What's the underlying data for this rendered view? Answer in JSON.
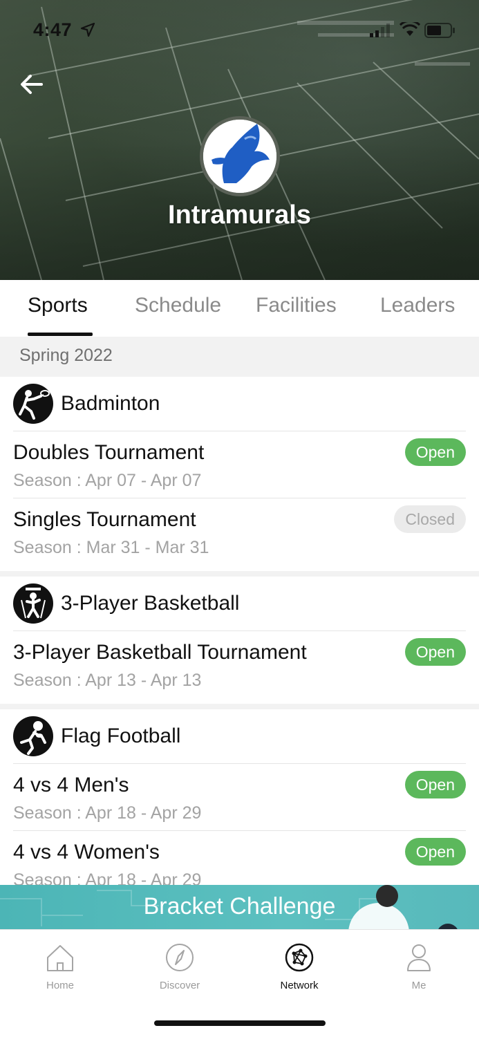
{
  "status_bar": {
    "time": "4:47",
    "location_icon": "location-arrow-icon",
    "signal_icon": "cellular-signal-icon",
    "wifi_icon": "wifi-icon",
    "battery_icon": "battery-icon"
  },
  "header": {
    "back_icon": "arrow-left-icon",
    "logo_icon": "hawk-logo",
    "title": "Intramurals"
  },
  "tabs": [
    {
      "label": "Sports",
      "active": true
    },
    {
      "label": "Schedule",
      "active": false
    },
    {
      "label": "Facilities",
      "active": false
    },
    {
      "label": "Leaders",
      "active": false
    }
  ],
  "season": {
    "label": "Spring 2022"
  },
  "sports": [
    {
      "name": "Badminton",
      "icon": "badminton-icon",
      "events": [
        {
          "title": "Doubles Tournament",
          "season": "Season : Apr 07 - Apr 07",
          "status": "Open"
        },
        {
          "title": "Singles Tournament",
          "season": "Season : Mar 31 - Mar 31",
          "status": "Closed"
        }
      ]
    },
    {
      "name": "3-Player Basketball",
      "icon": "basketball-icon",
      "events": [
        {
          "title": "3-Player Basketball Tournament",
          "season": "Season : Apr 13 - Apr 13",
          "status": "Open"
        }
      ]
    },
    {
      "name": "Flag Football",
      "icon": "flag-football-icon",
      "events": [
        {
          "title": "4 vs 4 Men's",
          "season": "Season : Apr 18 - Apr 29",
          "status": "Open"
        },
        {
          "title": "4 vs 4 Women's",
          "season": "Season : Apr 18 - Apr 29",
          "status": "Open"
        }
      ]
    }
  ],
  "banner": {
    "label": "Bracket Challenge"
  },
  "bottom_nav": [
    {
      "label": "Home",
      "icon": "home-icon",
      "active": false
    },
    {
      "label": "Discover",
      "icon": "compass-icon",
      "active": false
    },
    {
      "label": "Network",
      "icon": "network-icon",
      "active": true
    },
    {
      "label": "Me",
      "icon": "person-icon",
      "active": false
    }
  ],
  "colors": {
    "open": "#5cb85c",
    "closed_bg": "#ebebeb",
    "banner": "#55bcbd",
    "active_tab": "#111111"
  }
}
